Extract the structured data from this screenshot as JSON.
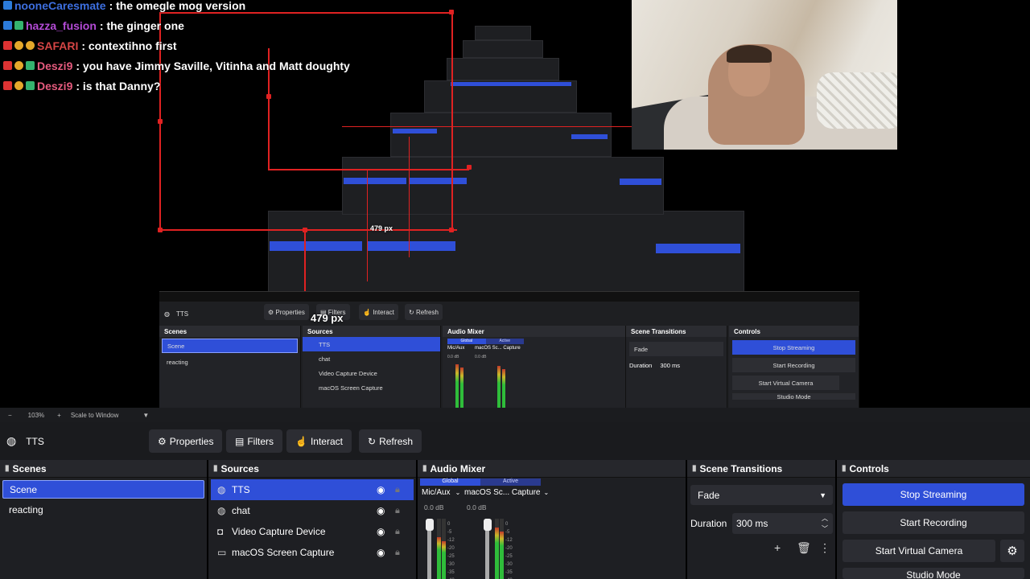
{
  "chat": [
    {
      "user": "nooneCaresmate",
      "user_color": "#3d6fe0",
      "message": ": the omegle mog version",
      "badges": [
        "blue"
      ]
    },
    {
      "user": "hazza_fusion",
      "user_color": "#b44bd6",
      "message": ": the ginger one",
      "badges": [
        "blue",
        "green"
      ]
    },
    {
      "user": "SAFARI",
      "user_color": "#d64545",
      "message": ": contextihno first",
      "badges": [
        "red",
        "gold",
        "gold"
      ]
    },
    {
      "user": "Deszi9",
      "user_color": "#e65b7e",
      "message": ": you have Jimmy Saville, Vitinha and Matt doughty",
      "badges": [
        "red",
        "gold",
        "green"
      ]
    },
    {
      "user": "Deszi9",
      "user_color": "#e65b7e",
      "message": ": is that Danny?",
      "badges": [
        "red",
        "gold",
        "green"
      ]
    }
  ],
  "nested_preview": {
    "px_label": "479 px",
    "mini_px_label": "479 px",
    "scale_zoom": "103%",
    "scale_mode": "Scale to Window",
    "toolbar": {
      "source": "TTS",
      "properties": "Properties",
      "filters": "Filters",
      "interact": "Interact",
      "refresh": "Refresh"
    },
    "docks": {
      "scenes": "Scenes",
      "sources": "Sources",
      "audio_mixer": "Audio Mixer",
      "scene_transitions": "Scene Transitions",
      "controls": "Controls"
    },
    "scenes": [
      "Scene",
      "reacting"
    ],
    "sources": [
      "TTS",
      "chat",
      "Video Capture Device",
      "macOS Screen Capture"
    ],
    "transition": "Fade",
    "duration_label": "Duration",
    "duration": "300 ms",
    "mixer": {
      "global": "Global",
      "active": "Active",
      "ch1": "Mic/Aux",
      "ch2": "macOS Sc... Capture",
      "db1": "0.0 dB",
      "db2": "0.0 dB"
    },
    "controls": [
      "Stop Streaming",
      "Start Recording",
      "Start Virtual Camera",
      "Studio Mode"
    ]
  },
  "scalebar": {
    "minus": "−",
    "zoom": "103%",
    "plus": "+",
    "mode": "Scale to Window"
  },
  "toolbar": {
    "source_name": "TTS",
    "properties": "Properties",
    "filters": "Filters",
    "interact": "Interact",
    "refresh": "Refresh"
  },
  "scenes": {
    "title": "Scenes",
    "items": [
      "Scene",
      "reacting"
    ],
    "selected": "Scene"
  },
  "sources": {
    "title": "Sources",
    "items": [
      {
        "name": "TTS",
        "icon": "globe-icon"
      },
      {
        "name": "chat",
        "icon": "globe-icon"
      },
      {
        "name": "Video Capture Device",
        "icon": "camera-icon"
      },
      {
        "name": "macOS Screen Capture",
        "icon": "monitor-icon"
      }
    ]
  },
  "audio_mixer": {
    "title": "Audio Mixer",
    "global_label": "Global",
    "active_label": "Active",
    "channel1": {
      "name": "Mic/Aux",
      "db": "0.0 dB",
      "level": 0.7
    },
    "channel2": {
      "name": "macOS Sc... Capture",
      "db": "0.0 dB",
      "level": 0.85
    },
    "ticks": [
      "0",
      "-5",
      "-12",
      "-20",
      "-25",
      "-30",
      "-35",
      "-40"
    ]
  },
  "scene_transitions": {
    "title": "Scene Transitions",
    "transition": "Fade",
    "duration_label": "Duration",
    "duration": "300 ms"
  },
  "controls": {
    "title": "Controls",
    "stop_streaming": "Stop Streaming",
    "start_recording": "Start Recording",
    "start_virtual_camera": "Start Virtual Camera",
    "studio_mode": "Studio Mode"
  },
  "colors": {
    "accent": "#2f4fd8",
    "panel": "#1e1f23",
    "red_guide": "#e02222"
  }
}
